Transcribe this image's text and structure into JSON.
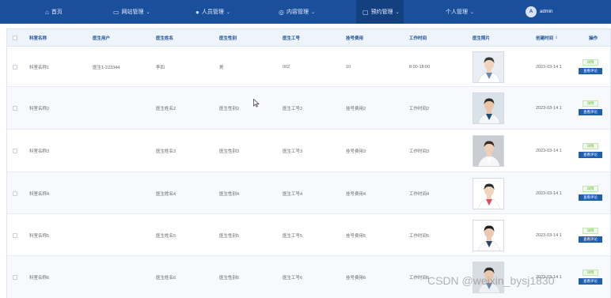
{
  "nav": {
    "items": [
      {
        "label": "首页",
        "icon": "home-icon"
      },
      {
        "label": "网站管理",
        "icon": "monitor-icon"
      },
      {
        "label": "人员管理",
        "icon": "user-icon"
      },
      {
        "label": "内容管理",
        "icon": "message-icon"
      },
      {
        "label": "预约管理",
        "icon": "calendar-icon"
      },
      {
        "label": "个人管理",
        "icon": "person-icon"
      }
    ],
    "username": "admin"
  },
  "table": {
    "headers": [
      "科室名称",
      "医生用户",
      "医生姓名",
      "医生性别",
      "医生工号",
      "挂号费用",
      "工作时间",
      "医生照片",
      "创建时间",
      "操作"
    ],
    "rows": [
      {
        "dept": "科室名称1",
        "user": "医生1-223344",
        "name": "李四",
        "gender": "男",
        "no": "002",
        "fee": "10",
        "time": "8:00-18:00",
        "created": "2023-03-14 1"
      },
      {
        "dept": "科室名称2",
        "user": "",
        "name": "医生姓名2",
        "gender": "医生性别2",
        "no": "医生工号2",
        "fee": "挂号费用2",
        "time": "工作时间2",
        "created": "2023-03-14 1"
      },
      {
        "dept": "科室名称3",
        "user": "",
        "name": "医生姓名3",
        "gender": "医生性别3",
        "no": "医生工号3",
        "fee": "挂号费用3",
        "time": "工作时间3",
        "created": "2023-03-14 1"
      },
      {
        "dept": "科室名称4",
        "user": "",
        "name": "医生姓名4",
        "gender": "医生性别4",
        "no": "医生工号4",
        "fee": "挂号费用4",
        "time": "工作时间4",
        "created": "2023-03-14 1"
      },
      {
        "dept": "科室名称5",
        "user": "",
        "name": "医生姓名5",
        "gender": "医生性别5",
        "no": "医生工号5",
        "fee": "挂号费用5",
        "time": "工作时间5",
        "created": "2023-03-14 1"
      },
      {
        "dept": "科室名称6",
        "user": "",
        "name": "医生姓名6",
        "gender": "医生性别6",
        "no": "医生工号6",
        "fee": "挂号费用6",
        "time": "工作时间6",
        "created": "2023-03-14 1"
      }
    ],
    "detail_label": "详情",
    "review_label": "查看评论"
  },
  "watermark": "CSDN @weixin_bysj1830",
  "colors": {
    "nav_bg": "#1a4f9c",
    "header_text": "#1a4f9c",
    "detail_green": "#67c23a",
    "review_blue": "#1e5fb0"
  }
}
